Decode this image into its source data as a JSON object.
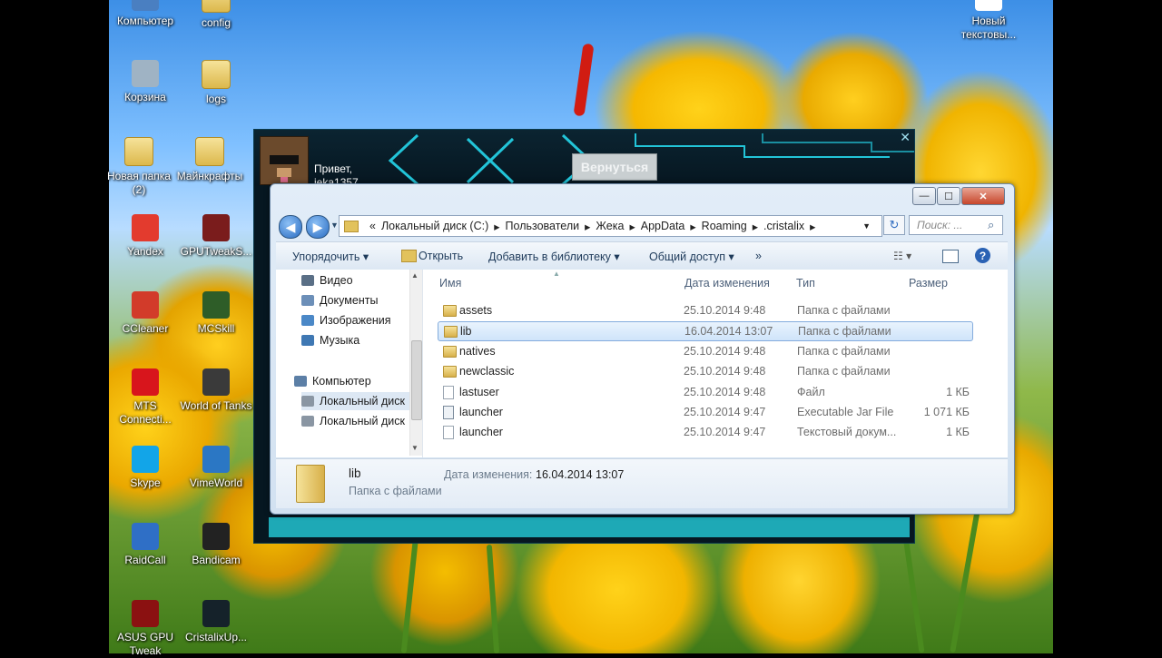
{
  "desktop": {
    "icons": [
      {
        "label": "Компьютер",
        "icon": "computer-icon",
        "color": "#4a7fc1"
      },
      {
        "label": "config",
        "icon": "folder-icon",
        "color": "#e2c25c"
      },
      {
        "label": "Корзина",
        "icon": "recycle-bin-icon",
        "color": "#9fb3c4"
      },
      {
        "label": "logs",
        "icon": "folder-icon",
        "color": "#e2c25c"
      },
      {
        "label": "Новая папка (2)",
        "icon": "folder-icon",
        "color": "#e2c25c"
      },
      {
        "label": "Майнкрафты",
        "icon": "folder-icon",
        "color": "#e2c25c"
      },
      {
        "label": "Yandex",
        "icon": "yandex-icon",
        "color": "#e33b2e"
      },
      {
        "label": "GPUTweakS...",
        "icon": "gputweak-icon",
        "color": "#7a1c1c"
      },
      {
        "label": "CCleaner",
        "icon": "ccleaner-icon",
        "color": "#d23b2a"
      },
      {
        "label": "MCSkill",
        "icon": "pickaxe-icon",
        "color": "#2e5d28"
      },
      {
        "label": "MTS Connecti...",
        "icon": "mts-icon",
        "color": "#d8151c"
      },
      {
        "label": "World of Tanks",
        "icon": "tanks-icon",
        "color": "#3a3a3a"
      },
      {
        "label": "Skype",
        "icon": "skype-icon",
        "color": "#12a5e8"
      },
      {
        "label": "VimeWorld",
        "icon": "vimeworld-icon",
        "color": "#2b77c4"
      },
      {
        "label": "RaidCall",
        "icon": "raidcall-icon",
        "color": "#2f6fc6"
      },
      {
        "label": "Bandicam",
        "icon": "bandicam-icon",
        "color": "#222222"
      },
      {
        "label": "ASUS GPU Tweak",
        "icon": "asus-gpu-icon",
        "color": "#8b1111"
      },
      {
        "label": "CristalixUp...",
        "icon": "cristalix-icon",
        "color": "#15222a"
      },
      {
        "label": "Новый текстовы...",
        "icon": "text-file-icon",
        "color": "#ffffff"
      }
    ]
  },
  "launcher": {
    "greeting": "Привет,",
    "username": "ieka1357",
    "back_button": "Вернуться",
    "close": "✕",
    "accent": "#1ea9b6"
  },
  "explorer": {
    "window_controls": {
      "minimize": "—",
      "maximize": "☐",
      "close": "✕"
    },
    "breadcrumb": [
      "Локальный диск (C:)",
      "Пользователи",
      "Жека",
      "AppData",
      "Roaming",
      ".cristalix"
    ],
    "breadcrumb_prefix": "«",
    "search_placeholder": "Поиск: ...",
    "toolbar": {
      "organize": "Упорядочить ▾",
      "open": "Открыть",
      "add_to_library": "Добавить в библиотеку ▾",
      "share": "Общий доступ ▾",
      "more": "»"
    },
    "nav": {
      "items": [
        {
          "label": "Видео",
          "icon": "video-library-icon",
          "color": "#5a6f86"
        },
        {
          "label": "Документы",
          "icon": "documents-library-icon",
          "color": "#6c8fb8"
        },
        {
          "label": "Изображения",
          "icon": "pictures-library-icon",
          "color": "#4b88c7"
        },
        {
          "label": "Музыка",
          "icon": "music-library-icon",
          "color": "#3f78b3"
        },
        {
          "label": "Компьютер",
          "icon": "computer-icon",
          "color": "#5c7fa6"
        },
        {
          "label": "Локальный диск",
          "icon": "drive-icon",
          "color": "#8a96a3"
        },
        {
          "label": "Локальный диск",
          "icon": "drive-icon",
          "color": "#8a96a3"
        }
      ]
    },
    "columns": {
      "name": "Имя",
      "date": "Дата изменения",
      "type": "Тип",
      "size": "Размер"
    },
    "files": [
      {
        "name": "assets",
        "date": "25.10.2014 9:48",
        "type": "Папка с файлами",
        "size": "",
        "kind": "dir"
      },
      {
        "name": "lib",
        "date": "16.04.2014 13:07",
        "type": "Папка с файлами",
        "size": "",
        "kind": "dir",
        "selected": true
      },
      {
        "name": "natives",
        "date": "25.10.2014 9:48",
        "type": "Папка с файлами",
        "size": "",
        "kind": "dir"
      },
      {
        "name": "newclassic",
        "date": "25.10.2014 9:48",
        "type": "Папка с файлами",
        "size": "",
        "kind": "dir"
      },
      {
        "name": "lastuser",
        "date": "25.10.2014 9:48",
        "type": "Файл",
        "size": "1 КБ",
        "kind": "file"
      },
      {
        "name": "launcher",
        "date": "25.10.2014 9:47",
        "type": "Executable Jar File",
        "size": "1 071 КБ",
        "kind": "jar"
      },
      {
        "name": "launcher",
        "date": "25.10.2014 9:47",
        "type": "Текстовый докум...",
        "size": "1 КБ",
        "kind": "file"
      }
    ],
    "details": {
      "name": "lib",
      "type": "Папка с файлами",
      "date_label": "Дата изменения:",
      "date_value": "16.04.2014 13:07"
    }
  }
}
